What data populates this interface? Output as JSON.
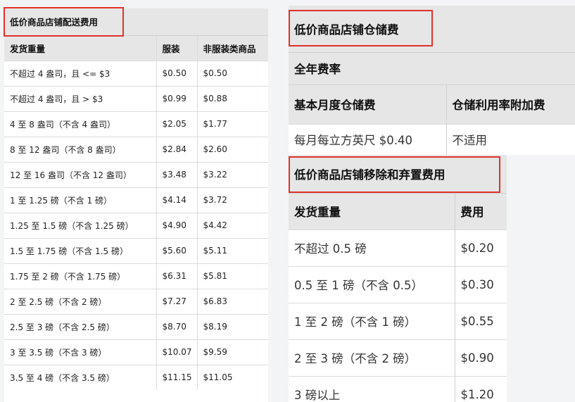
{
  "left_table": {
    "title": "低价商品店铺配送费用",
    "headers": [
      "发货重量",
      "服装",
      "非服装类商品"
    ],
    "rows": [
      [
        "不超过 4 盎司，且 <= $3",
        "$0.50",
        "$0.50"
      ],
      [
        "不超过 4 盎司，且 > $3",
        "$0.99",
        "$0.88"
      ],
      [
        "4 至 8 盎司（不含 4 盎司）",
        "$2.05",
        "$1.77"
      ],
      [
        "8 至 12 盎司（不含 8 盎司）",
        "$2.84",
        "$2.60"
      ],
      [
        "12 至 16 盎司（不含 12 盎司）",
        "$3.48",
        "$3.22"
      ],
      [
        "1 至 1.25 磅（不含 1 磅）",
        "$4.14",
        "$3.72"
      ],
      [
        "1.25 至 1.5 磅（不含 1.25 磅）",
        "$4.90",
        "$4.42"
      ],
      [
        "1.5 至 1.75 磅（不含 1.5 磅）",
        "$5.60",
        "$5.11"
      ],
      [
        "1.75 至 2 磅（不含 1.75 磅）",
        "$6.31",
        "$5.81"
      ],
      [
        "2 至 2.5 磅（不含 2 磅）",
        "$7.27",
        "$6.83"
      ],
      [
        "2.5 至 3 磅（不含 2.5 磅）",
        "$8.70",
        "$8.19"
      ],
      [
        "3 至 3.5 磅（不含 3 磅）",
        "$10.07",
        "$9.59"
      ],
      [
        "3.5 至 4 磅（不含 3.5 磅）",
        "$11.15",
        "$11.05"
      ]
    ]
  },
  "storage_table": {
    "title": "低价商品店铺仓储费",
    "subtitle": "全年费率",
    "headers": [
      "基本月度仓储费",
      "仓储利用率附加费"
    ],
    "row": [
      "每月每立方英尺 $0.40",
      "不适用"
    ]
  },
  "removal_table": {
    "title": "低价商品店铺移除和弃置费用",
    "headers": [
      "发货重量",
      "费用"
    ],
    "rows": [
      [
        "不超过 0.5 磅",
        "$0.20"
      ],
      [
        "0.5 至 1 磅（不含 0.5）",
        "$0.30"
      ],
      [
        "1 至 2 磅（不含 1 磅）",
        "$0.55"
      ],
      [
        "2 至 3 磅（不含 2 磅）",
        "$0.90"
      ],
      [
        "3 磅以上",
        "$1.20"
      ]
    ]
  },
  "colors": {
    "highlight_border": "#e0312a",
    "header_bg": "#e6e6e6",
    "page_bg": "#f3f4f5"
  }
}
